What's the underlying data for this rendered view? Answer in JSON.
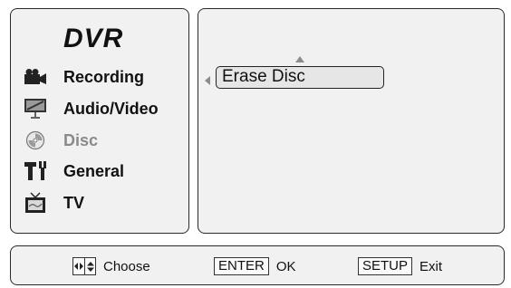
{
  "menu": {
    "title": "DVR",
    "items": [
      {
        "label": "Recording",
        "icon": "camcorder-icon"
      },
      {
        "label": "Audio/Video",
        "icon": "monitor-icon"
      },
      {
        "label": "Disc",
        "icon": "disc-icon",
        "disabled": true
      },
      {
        "label": "General",
        "icon": "tools-icon"
      },
      {
        "label": "TV",
        "icon": "tv-icon"
      }
    ]
  },
  "submenu": {
    "option_label": "Erase Disc"
  },
  "footer": {
    "choose_label": "Choose",
    "enter_key": "ENTER",
    "enter_label": "OK",
    "setup_key": "SETUP",
    "setup_label": "Exit"
  }
}
